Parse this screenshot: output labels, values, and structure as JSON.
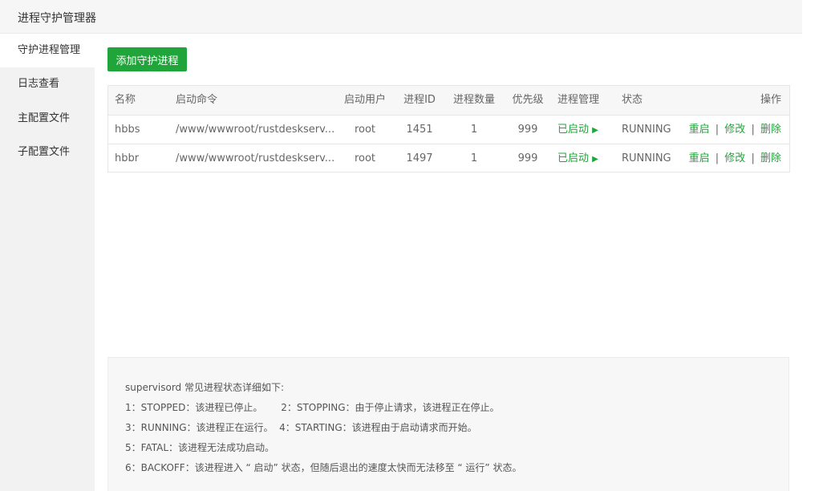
{
  "window": {
    "title": "进程守护管理器"
  },
  "sidebar": {
    "items": [
      {
        "label": "守护进程管理"
      },
      {
        "label": "日志查看"
      },
      {
        "label": "主配置文件"
      },
      {
        "label": "子配置文件"
      }
    ],
    "active_index": 0
  },
  "toolbar": {
    "add_label": "添加守护进程"
  },
  "table": {
    "headers": {
      "name": "名称",
      "cmd": "启动命令",
      "user": "启动用户",
      "pid": "进程ID",
      "count": "进程数量",
      "priority": "优先级",
      "mgmt": "进程管理",
      "state": "状态",
      "ops": "操作"
    },
    "rows": [
      {
        "name": "hbbs",
        "cmd": "/www/wwwroot/rustdeskserv...",
        "user": "root",
        "pid": "1451",
        "count": "1",
        "priority": "999",
        "mgmt": "已启动",
        "state": "RUNNING",
        "op_restart": "重启",
        "op_edit": "修改",
        "op_delete": "删除"
      },
      {
        "name": "hbbr",
        "cmd": "/www/wwwroot/rustdeskserv...",
        "user": "root",
        "pid": "1497",
        "count": "1",
        "priority": "999",
        "mgmt": "已启动",
        "state": "RUNNING",
        "op_restart": "重启",
        "op_edit": "修改",
        "op_delete": "删除"
      }
    ],
    "op_separator": "|"
  },
  "info": {
    "lines": [
      "supervisord 常见进程状态详细如下:",
      "1：STOPPED：该进程已停止。      2：STOPPING：由于停止请求，该进程正在停止。",
      "3：RUNNING：该进程正在运行。  4：STARTING：该进程由于启动请求而开始。",
      "5：FATAL：该进程无法成功启动。",
      "6：BACKOFF：该进程进入 “ 启动” 状态，但随后退出的速度太快而无法移至 “ 运行” 状态。"
    ]
  },
  "colors": {
    "accent": "#20a53a",
    "sidebar_bg": "#f2f2f2",
    "header_bg": "#f7f7f7"
  }
}
